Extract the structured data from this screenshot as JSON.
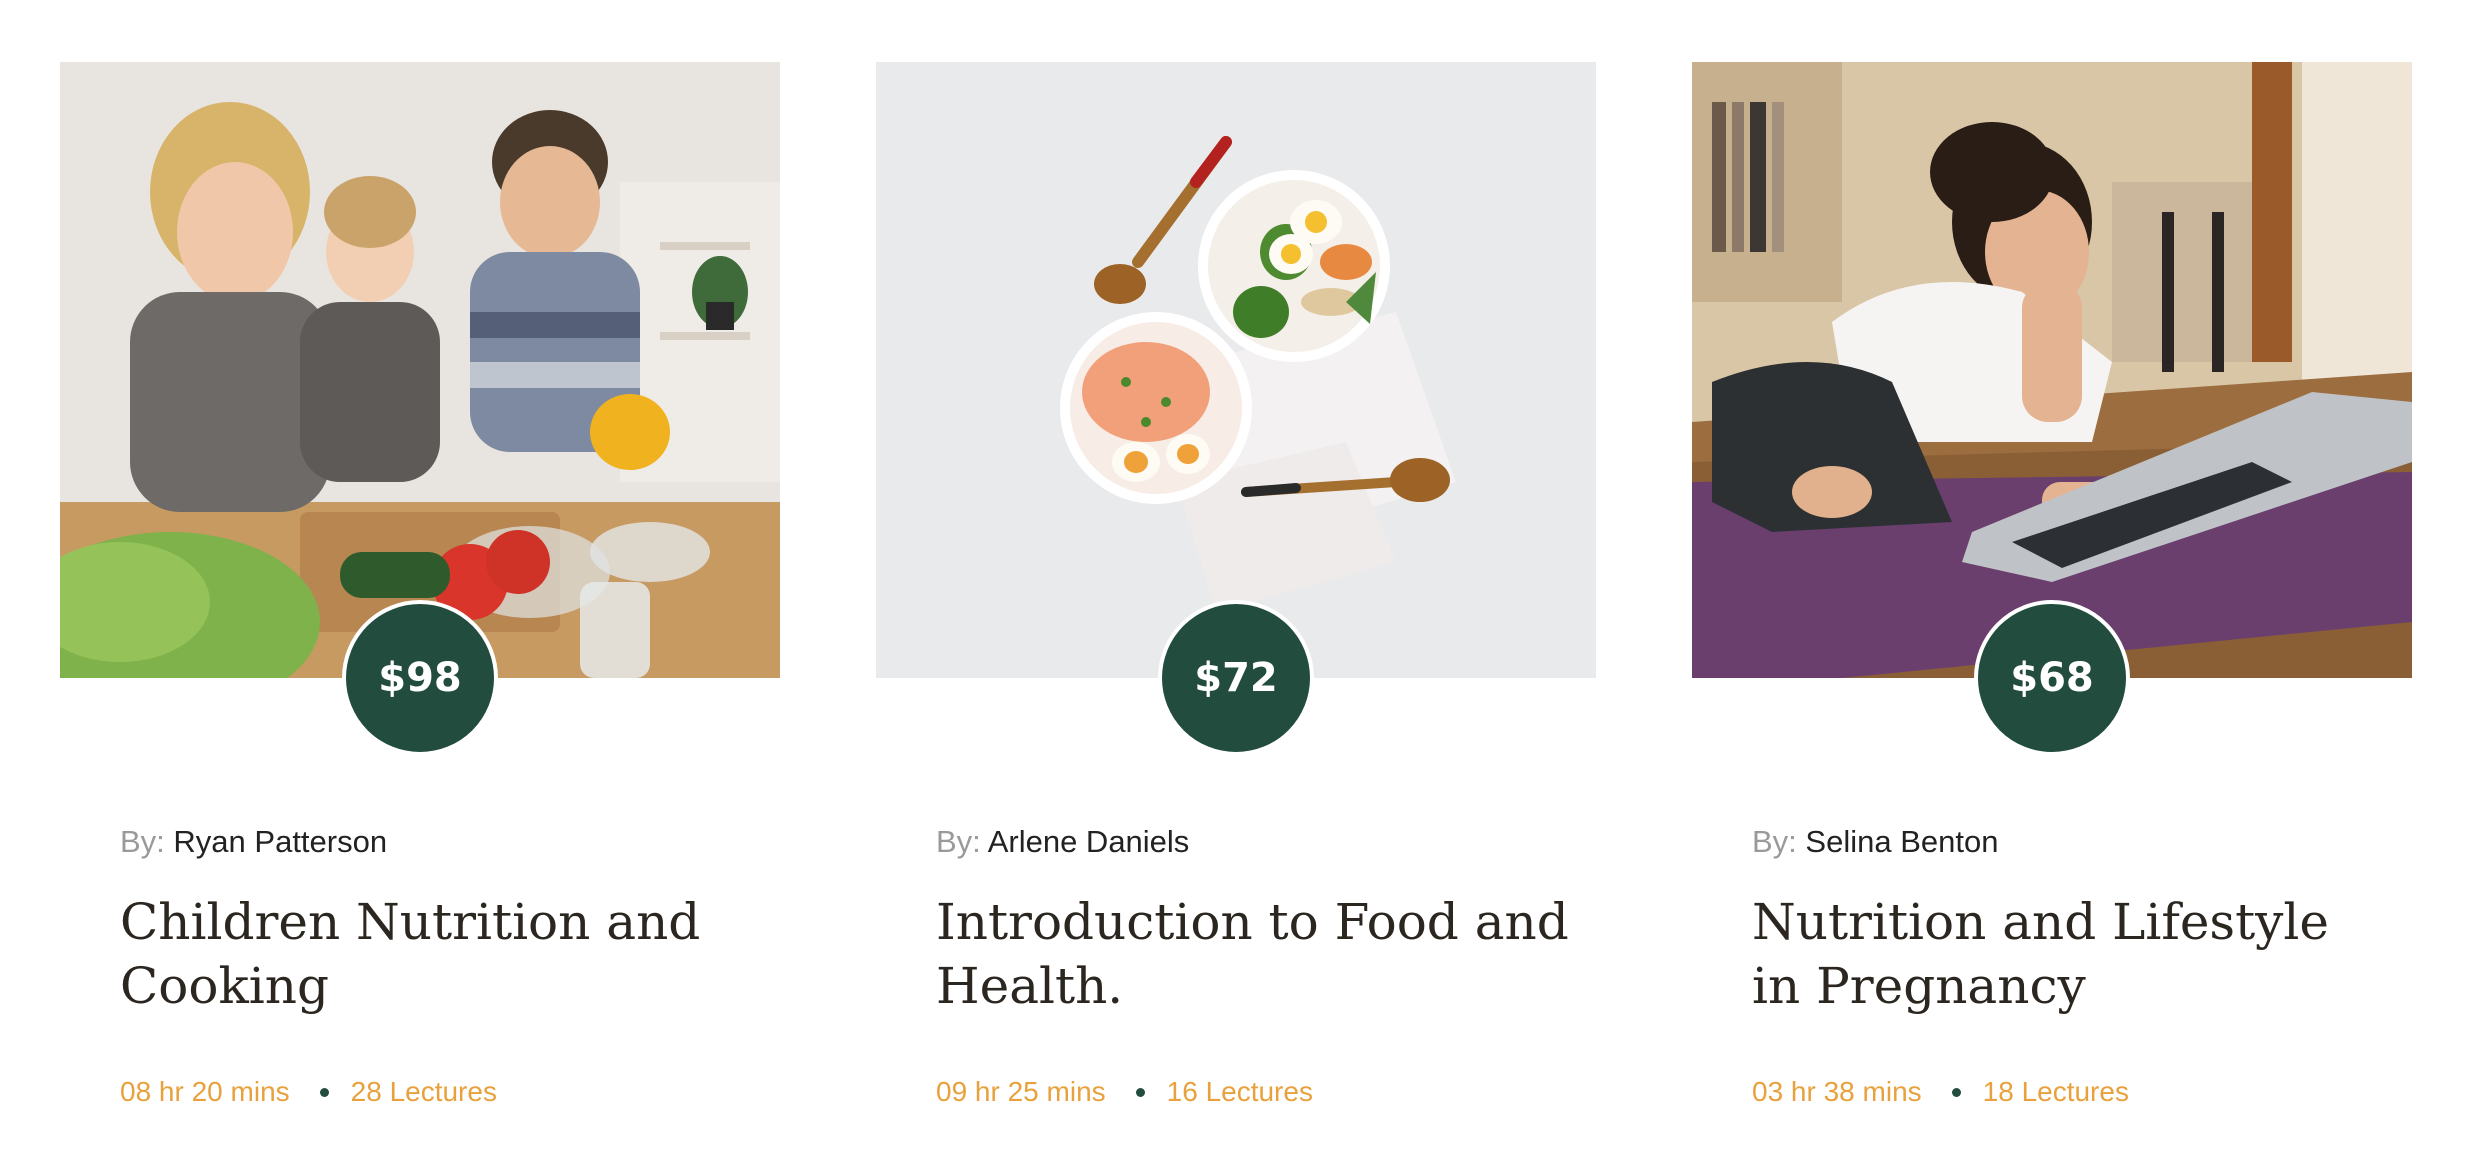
{
  "colors": {
    "accent": "#214c3e",
    "meta": "#e8a13c",
    "title": "#2b2620",
    "byline_label": "#9a9a9a"
  },
  "courses": [
    {
      "price": "$98",
      "by_label": "By:",
      "author": "Ryan Patterson",
      "title": "Children Nutrition and Cooking",
      "duration": "08 hr 20 mins",
      "lectures": "28 Lectures"
    },
    {
      "price": "$72",
      "by_label": "By:",
      "author": "Arlene Daniels",
      "title": "Introduction to Food and Health.",
      "duration": "09 hr 25 mins",
      "lectures": "16 Lectures"
    },
    {
      "price": "$68",
      "by_label": "By:",
      "author": "Selina Benton",
      "title": "Nutrition and Lifestyle in Pregnancy",
      "duration": "03 hr 38 mins",
      "lectures": "18 Lectures"
    }
  ]
}
